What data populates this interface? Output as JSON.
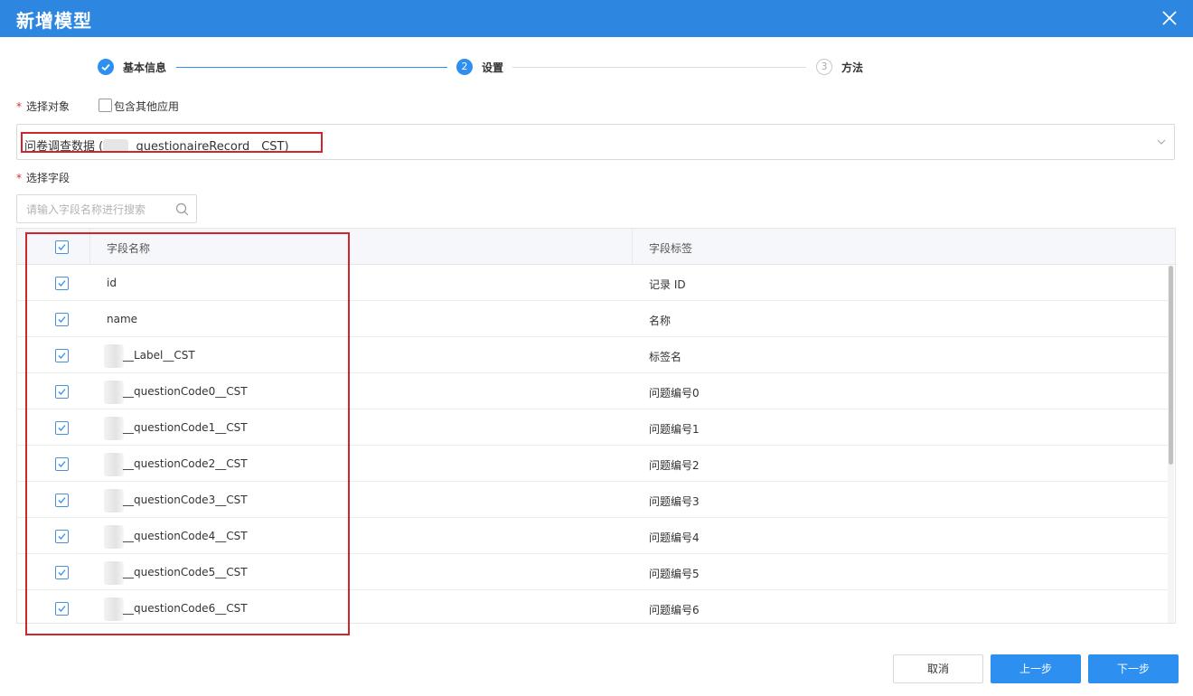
{
  "dialog": {
    "title": "新增模型"
  },
  "steps": [
    {
      "index": "1",
      "label": "基本信息",
      "state": "done"
    },
    {
      "index": "2",
      "label": "设置",
      "state": "active"
    },
    {
      "index": "3",
      "label": "方法",
      "state": "pending"
    }
  ],
  "object_section": {
    "required_mark": "*",
    "label": "选择对象",
    "include_other_apps_label": "包含其他应用",
    "include_other_apps_checked": false,
    "selected_value_prefix": "问卷调查数据 (",
    "selected_value_suffix": "questionaireRecord__CST)"
  },
  "field_section": {
    "required_mark": "*",
    "label": "选择字段",
    "search_placeholder": "请输入字段名称进行搜索"
  },
  "table": {
    "columns": {
      "name": "字段名称",
      "label": "字段标签"
    },
    "header_checked": true,
    "rows": [
      {
        "name": "id",
        "label": "记录 ID",
        "checked": true,
        "redacted": false
      },
      {
        "name": "name",
        "label": "名称",
        "checked": true,
        "redacted": false
      },
      {
        "name": "__Label__CST",
        "label": "标签名",
        "checked": true,
        "redacted": true
      },
      {
        "name": "__questionCode0__CST",
        "label": "问题编号0",
        "checked": true,
        "redacted": true
      },
      {
        "name": "__questionCode1__CST",
        "label": "问题编号1",
        "checked": true,
        "redacted": true
      },
      {
        "name": "__questionCode2__CST",
        "label": "问题编号2",
        "checked": true,
        "redacted": true
      },
      {
        "name": "__questionCode3__CST",
        "label": "问题编号3",
        "checked": true,
        "redacted": true
      },
      {
        "name": "__questionCode4__CST",
        "label": "问题编号4",
        "checked": true,
        "redacted": true
      },
      {
        "name": "__questionCode5__CST",
        "label": "问题编号5",
        "checked": true,
        "redacted": true
      },
      {
        "name": "__questionCode6__CST",
        "label": "问题编号6",
        "checked": true,
        "redacted": true
      }
    ]
  },
  "footer": {
    "cancel_label": "取消",
    "prev_label": "上一步",
    "next_label": "下一步"
  },
  "colors": {
    "header_bar": "#2d86e0",
    "primary_button": "#2d8ff0",
    "highlight_box": "#d0262a",
    "required_mark": "#e0302a"
  }
}
